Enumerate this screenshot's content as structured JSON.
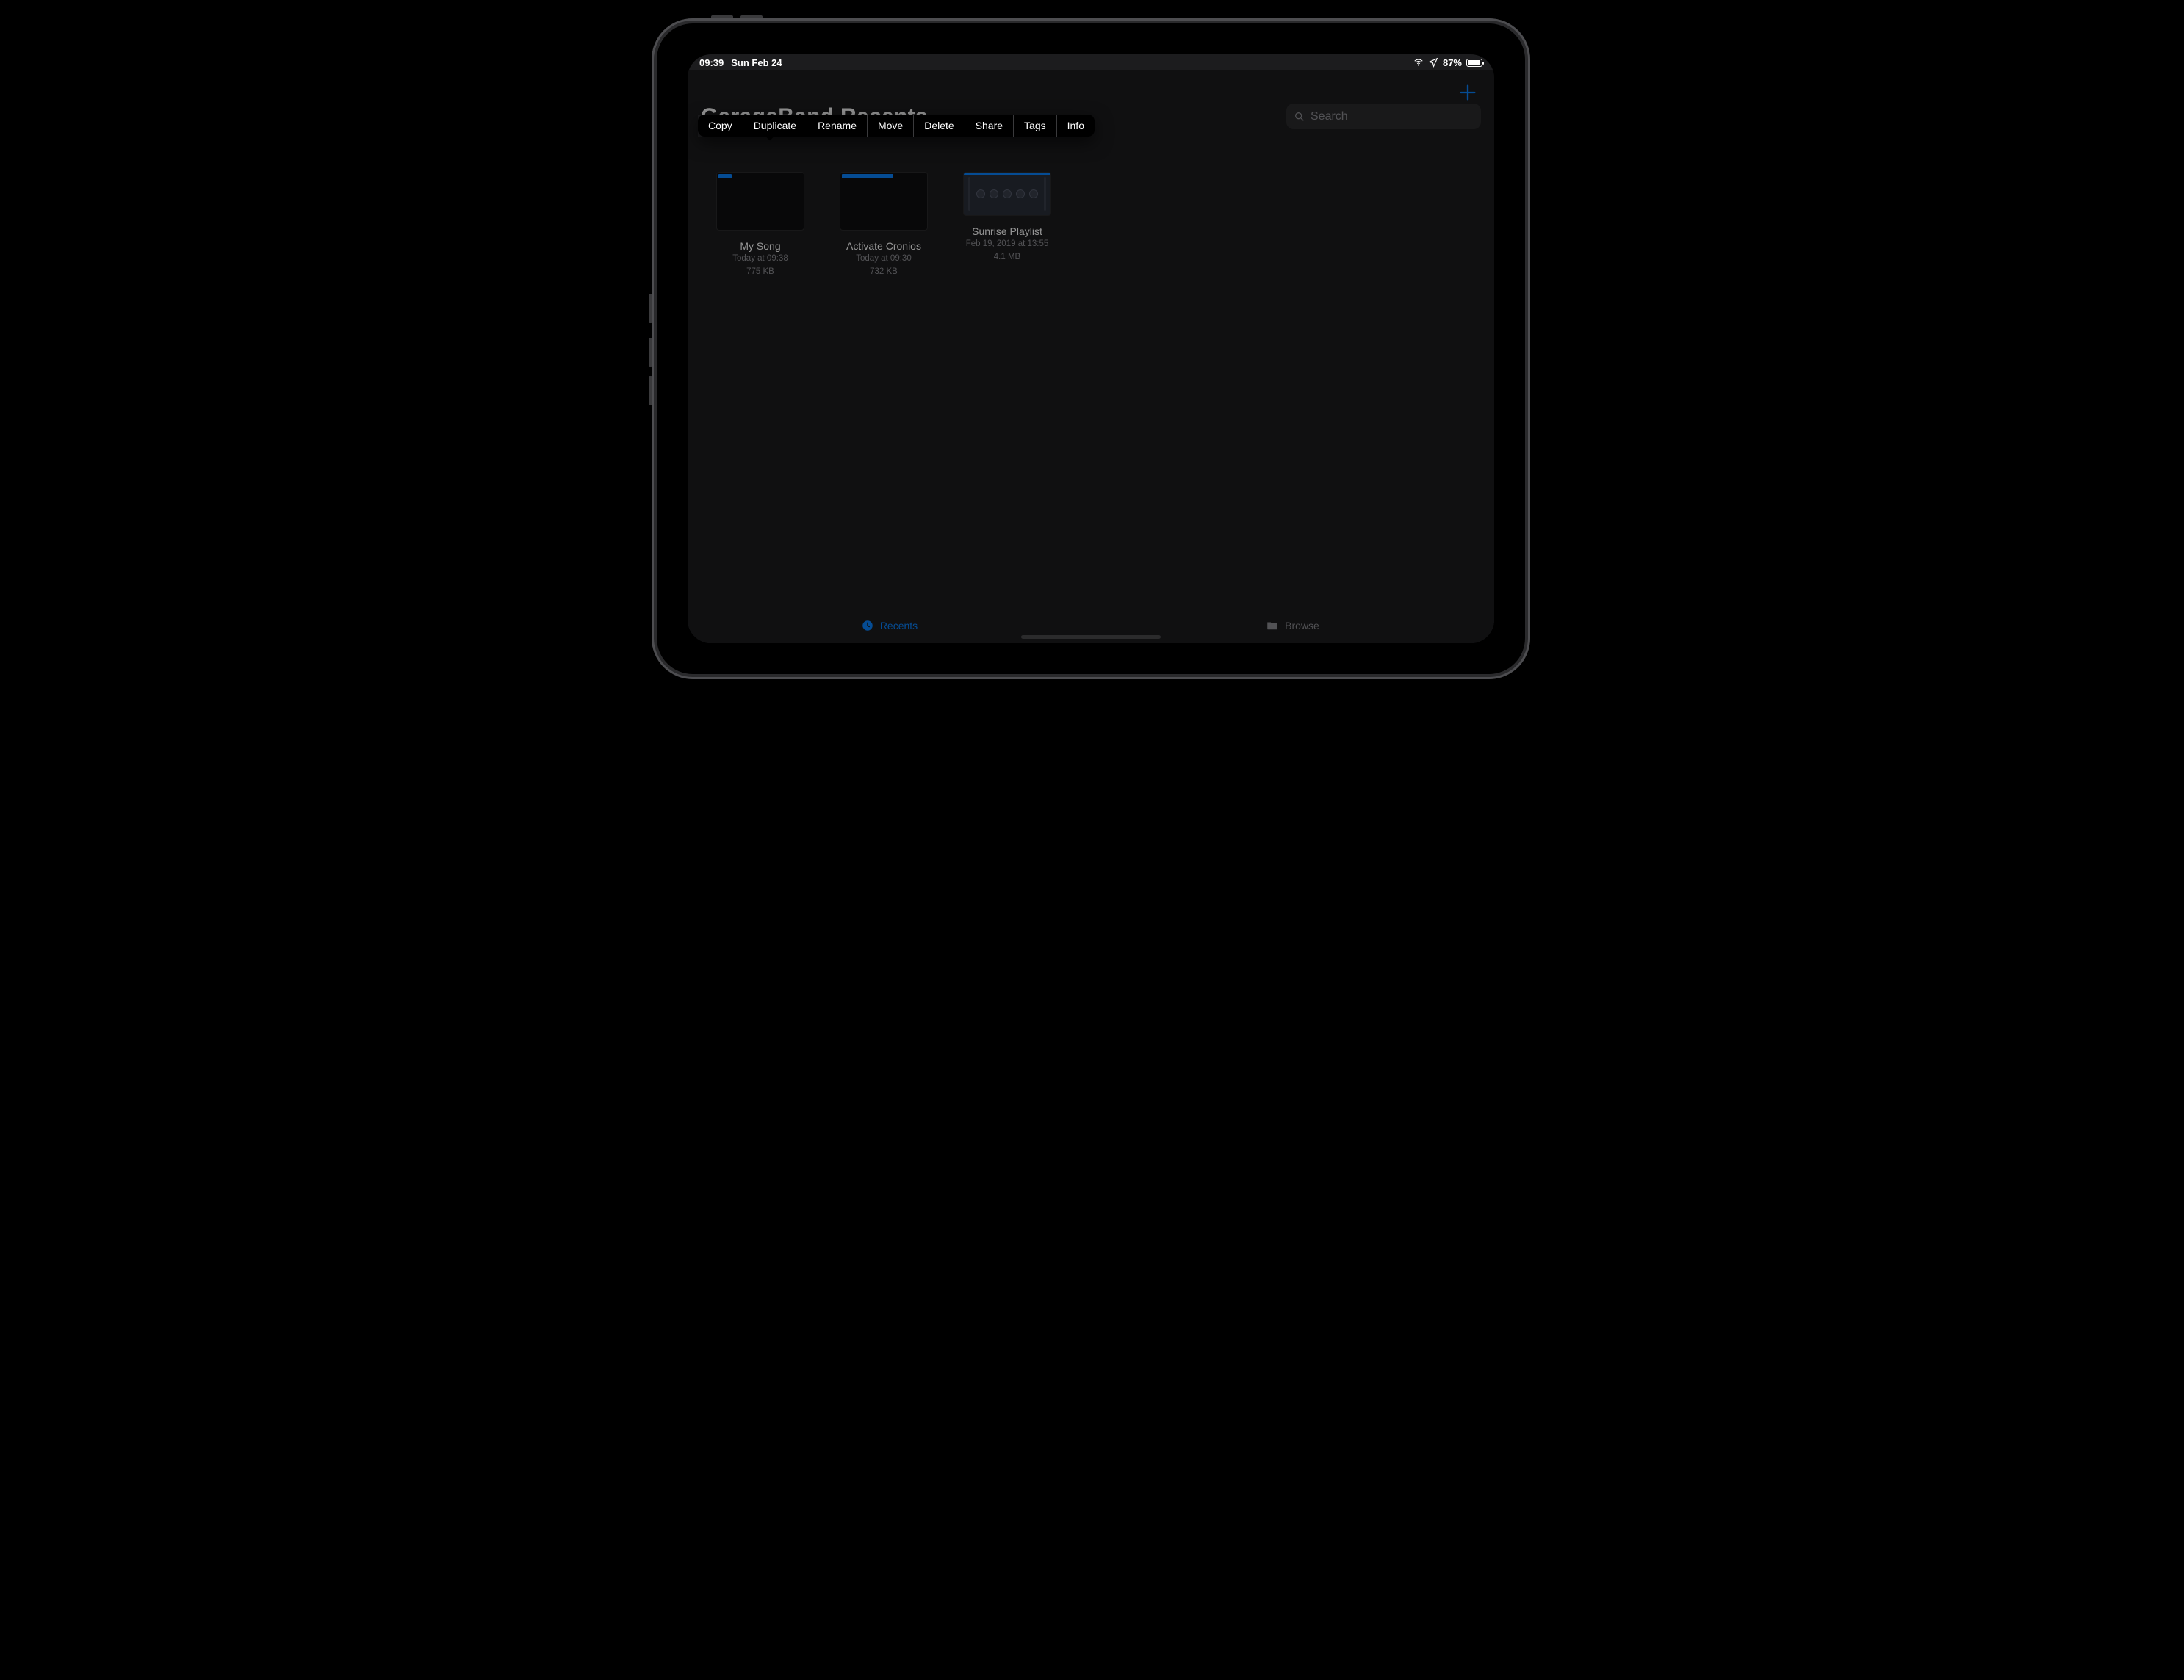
{
  "status": {
    "time": "09:39",
    "date": "Sun Feb 24",
    "battery_pct": "87%"
  },
  "header": {
    "title": "GarageBand Recents",
    "search_placeholder": "Search"
  },
  "popover": {
    "items": [
      {
        "id": "copy",
        "label": "Copy"
      },
      {
        "id": "duplicate",
        "label": "Duplicate"
      },
      {
        "id": "rename",
        "label": "Rename"
      },
      {
        "id": "move",
        "label": "Move"
      },
      {
        "id": "delete",
        "label": "Delete"
      },
      {
        "id": "share",
        "label": "Share"
      },
      {
        "id": "tags",
        "label": "Tags"
      },
      {
        "id": "info",
        "label": "Info"
      }
    ]
  },
  "files": [
    {
      "name": "My Song",
      "date": "Today at 09:38",
      "size": "775 KB",
      "thumb": "track",
      "track_w": 18
    },
    {
      "name": "Activate Cronios",
      "date": "Today at 09:30",
      "size": "732 KB",
      "thumb": "track",
      "track_w": 70
    },
    {
      "name": "Sunrise Playlist",
      "date": "Feb 19, 2019 at 13:55",
      "size": "4.1 MB",
      "thumb": "knobs"
    }
  ],
  "tabs": {
    "recents": "Recents",
    "browse": "Browse"
  }
}
